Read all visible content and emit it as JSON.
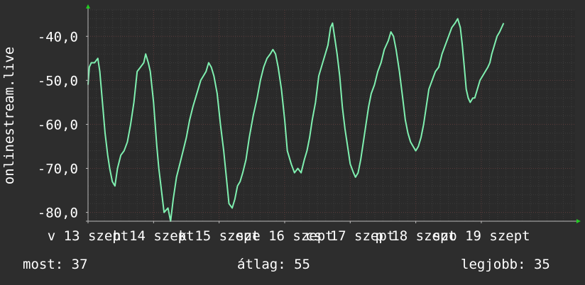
{
  "chart_data": {
    "type": "line",
    "ylabel": "onlinestream.live",
    "ylim": [
      -82,
      -34
    ],
    "yticks": [
      -80,
      -70,
      -60,
      -50,
      -40
    ],
    "ytick_labels": [
      "-80,0",
      "-70,0",
      "-60,0",
      "-50,0",
      "-40,0"
    ],
    "xlim": [
      0,
      7.43
    ],
    "xticks": [
      {
        "x": 0,
        "label": "v 13 szept"
      },
      {
        "x": 1,
        "label": "h 14 szept"
      },
      {
        "x": 2,
        "label": "k 15 szept"
      },
      {
        "x": 3,
        "label": "sze 16 szept"
      },
      {
        "x": 4,
        "label": "cs 17 szept"
      },
      {
        "x": 5,
        "label": "p 18 szept"
      },
      {
        "x": 6,
        "label": "szo 19 szept"
      }
    ],
    "grid": true,
    "colors": {
      "background": "#2d2d2d",
      "plot_bg": "#2a2a2a",
      "line": "#7ff0b0",
      "grid_major": "#5a3a3a",
      "grid_minor": "#3c3c3c",
      "axis_arrow": "#22cc22"
    },
    "series": [
      {
        "points": [
          [
            0.0,
            -51
          ],
          [
            0.02,
            -47
          ],
          [
            0.05,
            -46
          ],
          [
            0.1,
            -46
          ],
          [
            0.15,
            -45
          ],
          [
            0.18,
            -48
          ],
          [
            0.22,
            -55
          ],
          [
            0.26,
            -62
          ],
          [
            0.3,
            -67
          ],
          [
            0.33,
            -70
          ],
          [
            0.37,
            -73
          ],
          [
            0.41,
            -74
          ],
          [
            0.45,
            -70
          ],
          [
            0.5,
            -67
          ],
          [
            0.55,
            -66
          ],
          [
            0.6,
            -64
          ],
          [
            0.65,
            -60
          ],
          [
            0.7,
            -55
          ],
          [
            0.75,
            -48
          ],
          [
            0.8,
            -47
          ],
          [
            0.85,
            -46
          ],
          [
            0.88,
            -44
          ],
          [
            0.92,
            -46
          ],
          [
            0.95,
            -48
          ],
          [
            1.0,
            -55
          ],
          [
            1.05,
            -65
          ],
          [
            1.08,
            -70
          ],
          [
            1.12,
            -75
          ],
          [
            1.16,
            -80
          ],
          [
            1.22,
            -79
          ],
          [
            1.26,
            -82
          ],
          [
            1.3,
            -77
          ],
          [
            1.35,
            -72
          ],
          [
            1.4,
            -69
          ],
          [
            1.45,
            -66
          ],
          [
            1.5,
            -63
          ],
          [
            1.55,
            -59
          ],
          [
            1.6,
            -56
          ],
          [
            1.68,
            -52
          ],
          [
            1.72,
            -50
          ],
          [
            1.76,
            -49
          ],
          [
            1.8,
            -48
          ],
          [
            1.84,
            -46
          ],
          [
            1.88,
            -47
          ],
          [
            1.92,
            -49
          ],
          [
            1.97,
            -53
          ],
          [
            2.02,
            -60
          ],
          [
            2.07,
            -66
          ],
          [
            2.11,
            -72
          ],
          [
            2.15,
            -78
          ],
          [
            2.2,
            -79
          ],
          [
            2.24,
            -77
          ],
          [
            2.28,
            -74
          ],
          [
            2.32,
            -73
          ],
          [
            2.36,
            -71
          ],
          [
            2.41,
            -68
          ],
          [
            2.46,
            -63
          ],
          [
            2.52,
            -58
          ],
          [
            2.58,
            -54
          ],
          [
            2.63,
            -50
          ],
          [
            2.68,
            -47
          ],
          [
            2.73,
            -45
          ],
          [
            2.78,
            -44
          ],
          [
            2.82,
            -43
          ],
          [
            2.86,
            -44
          ],
          [
            2.9,
            -47
          ],
          [
            2.95,
            -52
          ],
          [
            3.0,
            -59
          ],
          [
            3.04,
            -66
          ],
          [
            3.1,
            -69
          ],
          [
            3.15,
            -71
          ],
          [
            3.2,
            -70
          ],
          [
            3.25,
            -71
          ],
          [
            3.3,
            -68
          ],
          [
            3.34,
            -66
          ],
          [
            3.38,
            -63
          ],
          [
            3.42,
            -59
          ],
          [
            3.47,
            -55
          ],
          [
            3.52,
            -49
          ],
          [
            3.58,
            -46
          ],
          [
            3.62,
            -44
          ],
          [
            3.66,
            -42
          ],
          [
            3.7,
            -38
          ],
          [
            3.73,
            -37
          ],
          [
            3.76,
            -40
          ],
          [
            3.8,
            -44
          ],
          [
            3.84,
            -49
          ],
          [
            3.88,
            -56
          ],
          [
            3.92,
            -61
          ],
          [
            3.95,
            -64
          ],
          [
            4.0,
            -69
          ],
          [
            4.05,
            -71
          ],
          [
            4.08,
            -72
          ],
          [
            4.12,
            -71
          ],
          [
            4.16,
            -68
          ],
          [
            4.2,
            -64
          ],
          [
            4.24,
            -60
          ],
          [
            4.28,
            -56
          ],
          [
            4.32,
            -53
          ],
          [
            4.37,
            -51
          ],
          [
            4.42,
            -48
          ],
          [
            4.47,
            -46
          ],
          [
            4.52,
            -43
          ],
          [
            4.58,
            -41
          ],
          [
            4.62,
            -39
          ],
          [
            4.66,
            -40
          ],
          [
            4.7,
            -43
          ],
          [
            4.75,
            -48
          ],
          [
            4.8,
            -54
          ],
          [
            4.84,
            -59
          ],
          [
            4.88,
            -62
          ],
          [
            4.92,
            -64
          ],
          [
            4.96,
            -65
          ],
          [
            5.0,
            -66
          ],
          [
            5.04,
            -65
          ],
          [
            5.08,
            -63
          ],
          [
            5.12,
            -60
          ],
          [
            5.16,
            -56
          ],
          [
            5.2,
            -52
          ],
          [
            5.25,
            -50
          ],
          [
            5.3,
            -48
          ],
          [
            5.35,
            -47
          ],
          [
            5.4,
            -44
          ],
          [
            5.45,
            -42
          ],
          [
            5.5,
            -40
          ],
          [
            5.55,
            -38
          ],
          [
            5.6,
            -37
          ],
          [
            5.64,
            -36
          ],
          [
            5.68,
            -38
          ],
          [
            5.71,
            -42
          ],
          [
            5.74,
            -47
          ],
          [
            5.77,
            -52
          ],
          [
            5.8,
            -54
          ],
          [
            5.83,
            -55
          ],
          [
            5.87,
            -54
          ],
          [
            5.9,
            -54
          ],
          [
            5.94,
            -52
          ],
          [
            5.98,
            -50
          ],
          [
            6.02,
            -49
          ],
          [
            6.06,
            -48
          ],
          [
            6.1,
            -47
          ],
          [
            6.13,
            -46
          ],
          [
            6.16,
            -44
          ],
          [
            6.2,
            -42
          ],
          [
            6.24,
            -40
          ],
          [
            6.28,
            -39
          ],
          [
            6.31,
            -38
          ],
          [
            6.34,
            -37
          ]
        ]
      }
    ]
  },
  "stats": {
    "current": "most: 37",
    "average": "átlag: 55",
    "best": "legjobb: 35"
  }
}
